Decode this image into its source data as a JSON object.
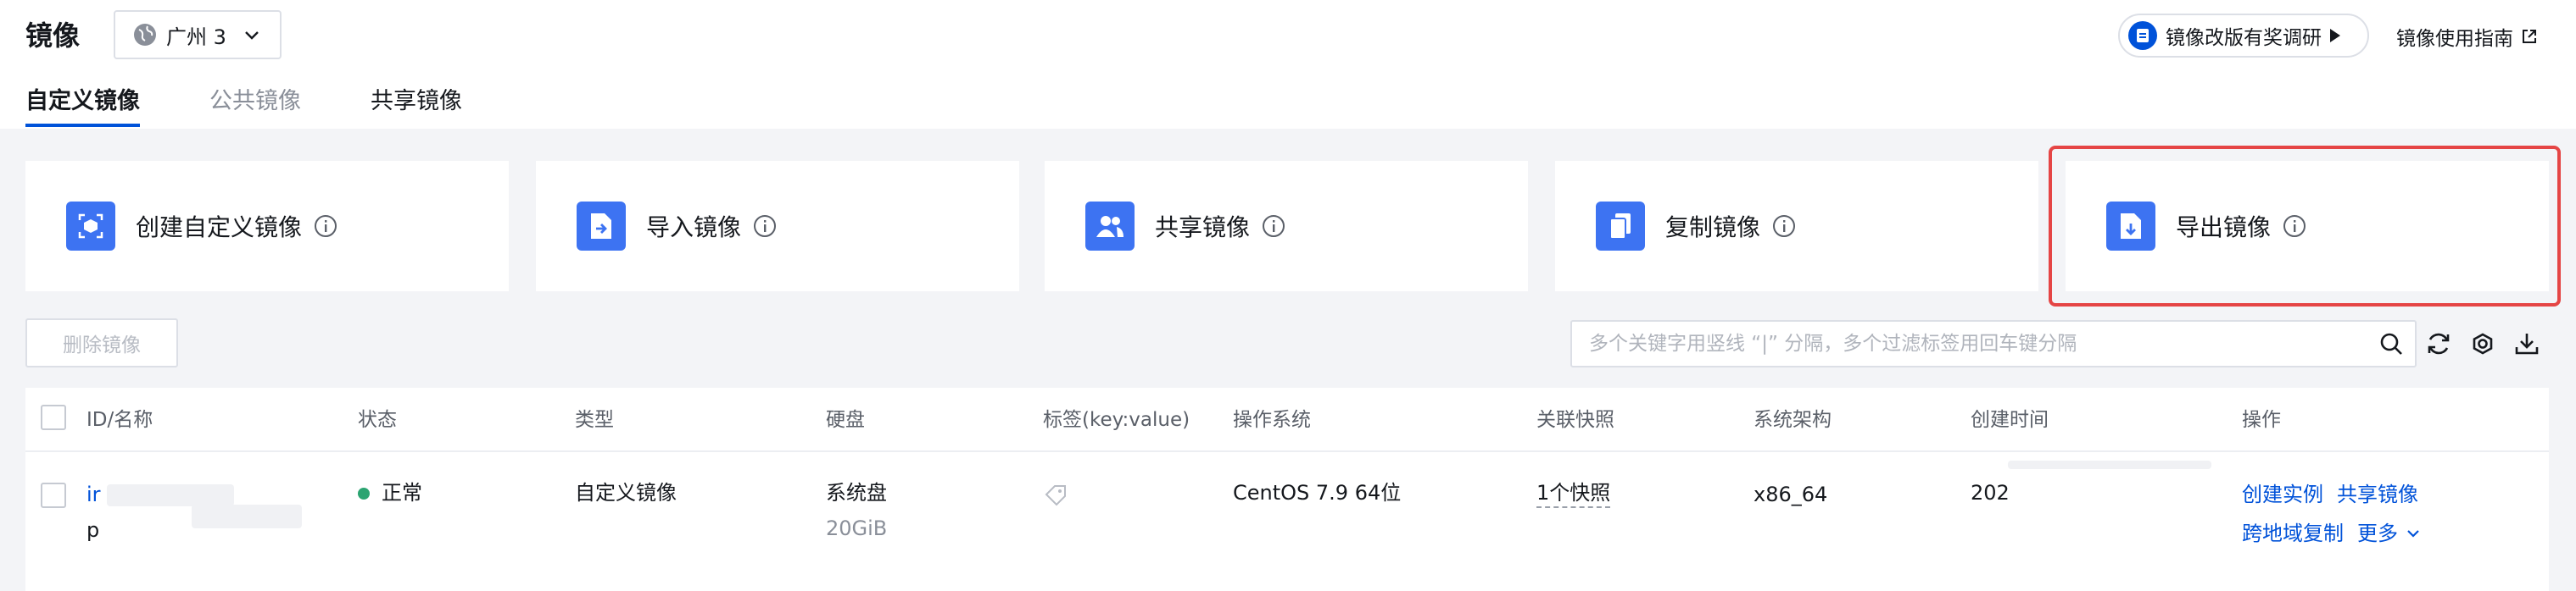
{
  "header": {
    "title": "镜像",
    "region": "广州 3",
    "survey": "镜像改版有奖调研",
    "guide": "镜像使用指南"
  },
  "tabs": [
    {
      "label": "自定义镜像"
    },
    {
      "label": "公共镜像"
    },
    {
      "label": "共享镜像"
    }
  ],
  "cards": [
    {
      "label": "创建自定义镜像",
      "icon": "create-image-icon"
    },
    {
      "label": "导入镜像",
      "icon": "import-image-icon"
    },
    {
      "label": "共享镜像",
      "icon": "share-image-icon"
    },
    {
      "label": "复制镜像",
      "icon": "copy-image-icon"
    },
    {
      "label": "导出镜像",
      "icon": "export-image-icon"
    }
  ],
  "toolbar": {
    "delete_label": "删除镜像",
    "search_placeholder": "多个关键字用竖线 “|” 分隔，多个过滤标签用回车键分隔"
  },
  "table": {
    "columns": [
      "ID/名称",
      "状态",
      "类型",
      "硬盘",
      "标签(key:value)",
      "操作系统",
      "关联快照",
      "系统架构",
      "创建时间",
      "操作"
    ],
    "rows": [
      {
        "id": "ir",
        "name": "p",
        "status": "正常",
        "type": "自定义镜像",
        "disk": "系统盘",
        "disk_size": "20GiB",
        "os": "CentOS 7.9 64位",
        "snapshot": "1个快照",
        "arch": "x86_64",
        "created": "202",
        "actions": {
          "create_instance": "创建实例",
          "share": "共享镜像",
          "cross_region_copy": "跨地域复制",
          "more": "更多"
        }
      }
    ]
  },
  "colors": {
    "accent": "#0052d9",
    "card_icon": "#3d73f2",
    "status_ok": "#2ba471",
    "highlight": "#e54545"
  }
}
